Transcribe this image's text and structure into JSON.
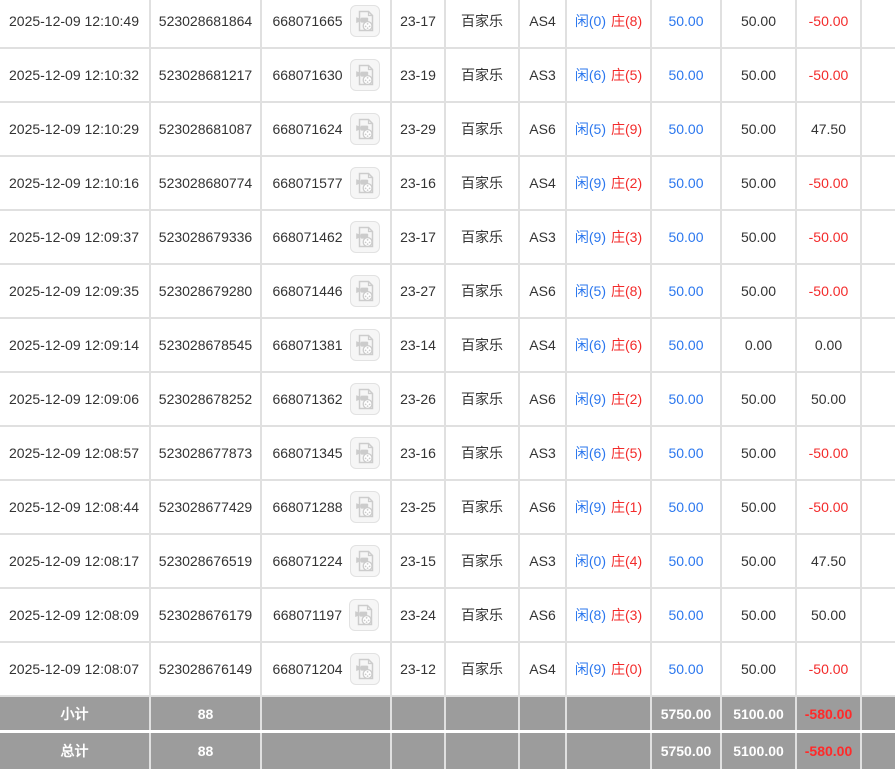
{
  "colors": {
    "text": "#333333",
    "blue_accent": "#2b77ee",
    "red_accent": "#f32b2b",
    "summary_background": "#9c9c9c",
    "summary_text": "#ffffff",
    "summary_red": "#ff2a2a",
    "grid_border": "#e0e0e0"
  },
  "icons": {
    "video_replay": "video-file-icon"
  },
  "table": {
    "game_name": "百家乐",
    "rows": [
      {
        "time": "2025-12-09 12:10:49",
        "bet_id": "523028681864",
        "round_id": "668071665",
        "table_no": "23-17",
        "game": "百家乐",
        "shoe": "AS4",
        "player": "闲(0)",
        "banker": "庄(8)",
        "bet": "50.00",
        "valid": "50.00",
        "winloss": "-50.00"
      },
      {
        "time": "2025-12-09 12:10:32",
        "bet_id": "523028681217",
        "round_id": "668071630",
        "table_no": "23-19",
        "game": "百家乐",
        "shoe": "AS3",
        "player": "闲(6)",
        "banker": "庄(5)",
        "bet": "50.00",
        "valid": "50.00",
        "winloss": "-50.00"
      },
      {
        "time": "2025-12-09 12:10:29",
        "bet_id": "523028681087",
        "round_id": "668071624",
        "table_no": "23-29",
        "game": "百家乐",
        "shoe": "AS6",
        "player": "闲(5)",
        "banker": "庄(9)",
        "bet": "50.00",
        "valid": "50.00",
        "winloss": "47.50"
      },
      {
        "time": "2025-12-09 12:10:16",
        "bet_id": "523028680774",
        "round_id": "668071577",
        "table_no": "23-16",
        "game": "百家乐",
        "shoe": "AS4",
        "player": "闲(9)",
        "banker": "庄(2)",
        "bet": "50.00",
        "valid": "50.00",
        "winloss": "-50.00"
      },
      {
        "time": "2025-12-09 12:09:37",
        "bet_id": "523028679336",
        "round_id": "668071462",
        "table_no": "23-17",
        "game": "百家乐",
        "shoe": "AS3",
        "player": "闲(9)",
        "banker": "庄(3)",
        "bet": "50.00",
        "valid": "50.00",
        "winloss": "-50.00"
      },
      {
        "time": "2025-12-09 12:09:35",
        "bet_id": "523028679280",
        "round_id": "668071446",
        "table_no": "23-27",
        "game": "百家乐",
        "shoe": "AS6",
        "player": "闲(5)",
        "banker": "庄(8)",
        "bet": "50.00",
        "valid": "50.00",
        "winloss": "-50.00"
      },
      {
        "time": "2025-12-09 12:09:14",
        "bet_id": "523028678545",
        "round_id": "668071381",
        "table_no": "23-14",
        "game": "百家乐",
        "shoe": "AS4",
        "player": "闲(6)",
        "banker": "庄(6)",
        "bet": "50.00",
        "valid": "0.00",
        "winloss": "0.00"
      },
      {
        "time": "2025-12-09 12:09:06",
        "bet_id": "523028678252",
        "round_id": "668071362",
        "table_no": "23-26",
        "game": "百家乐",
        "shoe": "AS6",
        "player": "闲(9)",
        "banker": "庄(2)",
        "bet": "50.00",
        "valid": "50.00",
        "winloss": "50.00"
      },
      {
        "time": "2025-12-09 12:08:57",
        "bet_id": "523028677873",
        "round_id": "668071345",
        "table_no": "23-16",
        "game": "百家乐",
        "shoe": "AS3",
        "player": "闲(6)",
        "banker": "庄(5)",
        "bet": "50.00",
        "valid": "50.00",
        "winloss": "-50.00"
      },
      {
        "time": "2025-12-09 12:08:44",
        "bet_id": "523028677429",
        "round_id": "668071288",
        "table_no": "23-25",
        "game": "百家乐",
        "shoe": "AS6",
        "player": "闲(9)",
        "banker": "庄(1)",
        "bet": "50.00",
        "valid": "50.00",
        "winloss": "-50.00"
      },
      {
        "time": "2025-12-09 12:08:17",
        "bet_id": "523028676519",
        "round_id": "668071224",
        "table_no": "23-15",
        "game": "百家乐",
        "shoe": "AS3",
        "player": "闲(0)",
        "banker": "庄(4)",
        "bet": "50.00",
        "valid": "50.00",
        "winloss": "47.50"
      },
      {
        "time": "2025-12-09 12:08:09",
        "bet_id": "523028676179",
        "round_id": "668071197",
        "table_no": "23-24",
        "game": "百家乐",
        "shoe": "AS6",
        "player": "闲(8)",
        "banker": "庄(3)",
        "bet": "50.00",
        "valid": "50.00",
        "winloss": "50.00"
      },
      {
        "time": "2025-12-09 12:08:07",
        "bet_id": "523028676149",
        "round_id": "668071204",
        "table_no": "23-12",
        "game": "百家乐",
        "shoe": "AS4",
        "player": "闲(9)",
        "banker": "庄(0)",
        "bet": "50.00",
        "valid": "50.00",
        "winloss": "-50.00"
      }
    ],
    "summary": [
      {
        "label": "小计",
        "count": "88",
        "bet": "5750.00",
        "valid": "5100.00",
        "winloss": "-580.00"
      },
      {
        "label": "总计",
        "count": "88",
        "bet": "5750.00",
        "valid": "5100.00",
        "winloss": "-580.00"
      }
    ]
  }
}
